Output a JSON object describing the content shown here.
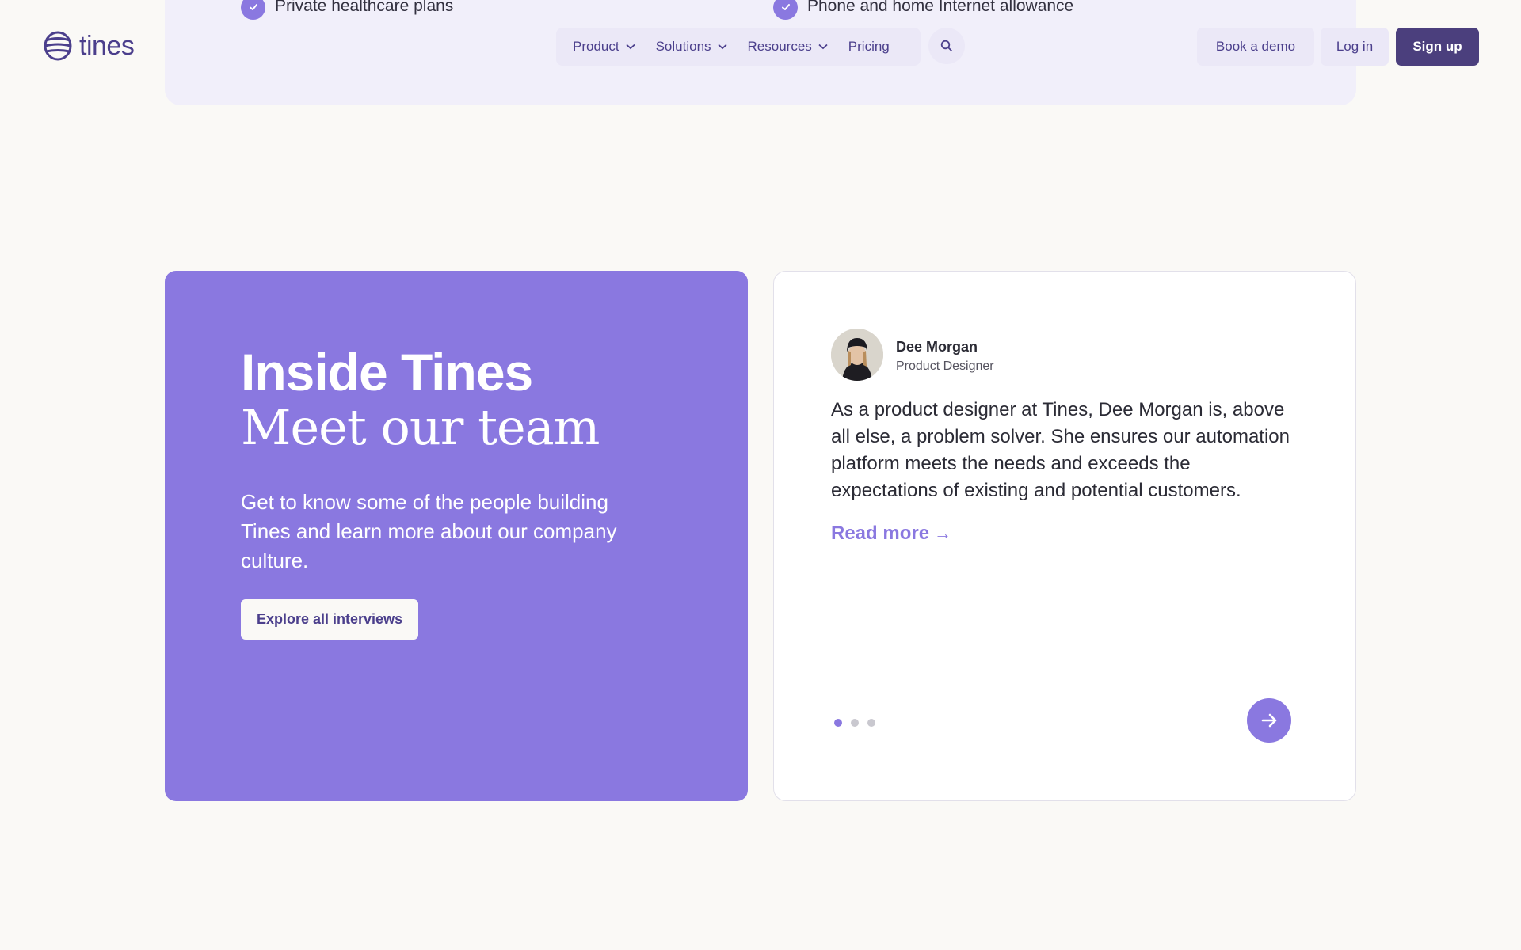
{
  "benefits": [
    {
      "label": "Private healthcare plans"
    },
    {
      "label": "Phone and home Internet allowance"
    }
  ],
  "header": {
    "logo_text": "tines",
    "nav": [
      {
        "label": "Product",
        "has_dropdown": true
      },
      {
        "label": "Solutions",
        "has_dropdown": true
      },
      {
        "label": "Resources",
        "has_dropdown": true
      },
      {
        "label": "Pricing",
        "has_dropdown": false
      }
    ],
    "search_icon": "search-icon",
    "book_demo": "Book a demo",
    "log_in": "Log in",
    "sign_up": "Sign up"
  },
  "team_section": {
    "title_line1": "Inside Tines",
    "title_line2": "Meet our team",
    "description": "Get to know some of the people building Tines and learn more about our company culture.",
    "cta": "Explore all interviews"
  },
  "testimonial": {
    "name": "Dee Morgan",
    "role": "Product Designer",
    "quote": "As a product designer at Tines, Dee Morgan is, above all else, a problem solver. She ensures our automation platform meets the needs and exceeds the expectations of existing and potential customers.",
    "read_more": "Read more",
    "slide_count": 3,
    "active_slide": 1
  },
  "colors": {
    "accent": "#8a78e0",
    "brand_dark": "#4b3f7d",
    "background": "#faf9f6",
    "nav_bg": "#ebe8f7"
  }
}
